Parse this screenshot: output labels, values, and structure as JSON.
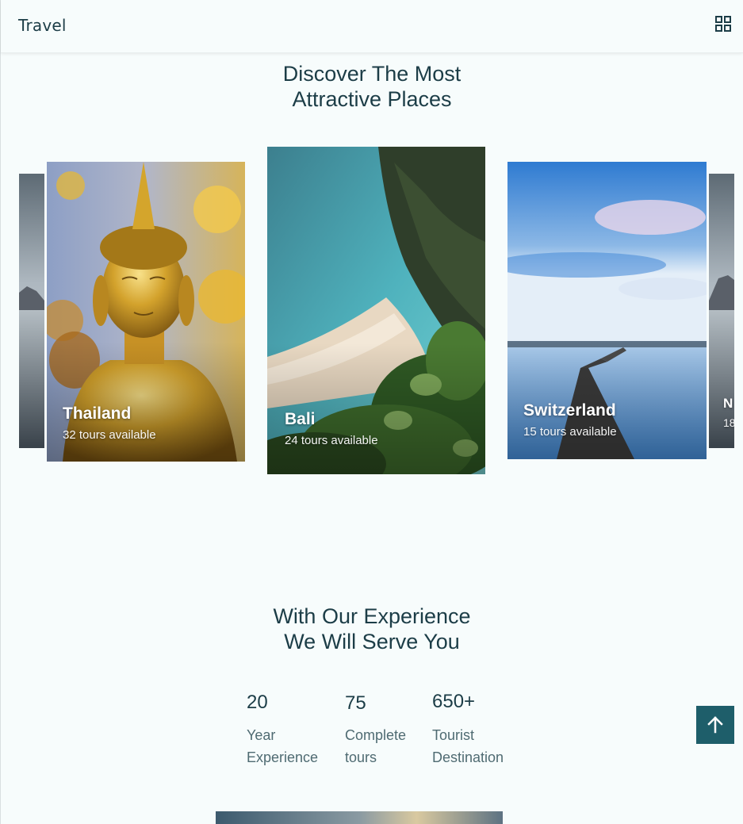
{
  "header": {
    "logo": "Travel",
    "menu_icon": "grid-icon"
  },
  "discover": {
    "title_line1": "Discover The Most",
    "title_line2": "Attractive Places",
    "cards": [
      {
        "name": "Thailand",
        "tours": "32 tours available"
      },
      {
        "name": "Bali",
        "tours": "24 tours available"
      },
      {
        "name": "Switzerland",
        "tours": "15 tours available"
      },
      {
        "name": "N",
        "tours": "18"
      }
    ]
  },
  "experience": {
    "title_line1": "With Our Experience",
    "title_line2": "We Will Serve You",
    "stats": [
      {
        "value": "20",
        "label_line1": "Year",
        "label_line2": "Experience"
      },
      {
        "value": "75",
        "label_line1": "Complete",
        "label_line2": "tours"
      },
      {
        "value": "650+",
        "label_line1": "Tourist",
        "label_line2": "Destination"
      }
    ]
  },
  "scroll_top_icon": "arrow-up-icon",
  "colors": {
    "background": "#f7fcfc",
    "heading": "#1c3d47",
    "accent": "#1e5e6a",
    "muted_text": "#4f6b72"
  }
}
